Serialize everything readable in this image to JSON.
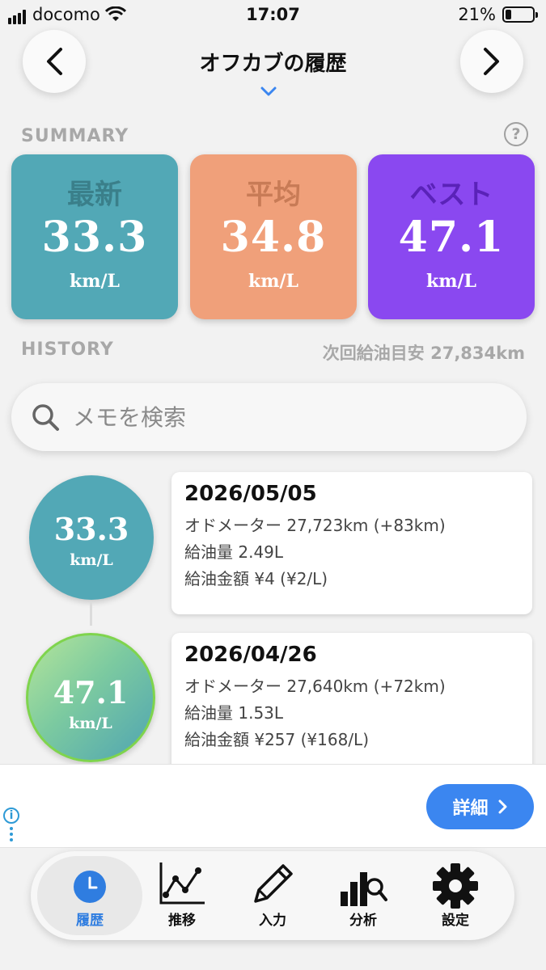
{
  "status_bar": {
    "carrier": "docomo",
    "time": "17:07",
    "battery": "21%",
    "battery_level": 0.21
  },
  "header": {
    "title": "オフカブの履歴"
  },
  "summary": {
    "label": "SUMMARY",
    "help": "?",
    "cards": [
      {
        "label": "最新",
        "value": "33.3",
        "unit": "km/L",
        "color": "#52a8b6"
      },
      {
        "label": "平均",
        "value": "34.8",
        "unit": "km/L",
        "color": "#f0a07a"
      },
      {
        "label": "ベスト",
        "value": "47.1",
        "unit": "km/L",
        "color": "#8a48f0"
      }
    ]
  },
  "history": {
    "label": "HISTORY",
    "next_fuel": "次回給油目安 27,834km",
    "entries": [
      {
        "value": "33.3",
        "unit": "km/L",
        "date": "2026/05/05",
        "odometer": "オドメーター 27,723km (+83km)",
        "fuel": "給油量 2.49L",
        "cost": "給油金額 ¥4 (¥2/L)"
      },
      {
        "value": "47.1",
        "unit": "km/L",
        "date": "2026/04/26",
        "odometer": "オドメーター 27,640km (+72km)",
        "fuel": "給油量 1.53L",
        "cost": "給油金額 ¥257 (¥168/L)"
      }
    ]
  },
  "search": {
    "placeholder": "メモを検索"
  },
  "ad": {
    "button_label": "詳細"
  },
  "tabs": [
    {
      "label": "履歴",
      "icon": "clock-icon",
      "active": true
    },
    {
      "label": "推移",
      "icon": "line-chart-icon",
      "active": false
    },
    {
      "label": "入力",
      "icon": "pencil-icon",
      "active": false
    },
    {
      "label": "分析",
      "icon": "bar-chart-search-icon",
      "active": false
    },
    {
      "label": "設定",
      "icon": "gear-icon",
      "active": false
    }
  ],
  "colors": {
    "accent": "#2f7de0",
    "ad_button": "#3b86f0",
    "best_ring": "#7fd44d"
  }
}
